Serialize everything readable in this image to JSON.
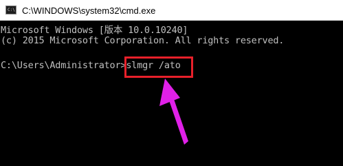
{
  "window": {
    "title": "C:\\WINDOWS\\system32\\cmd.exe",
    "icon": "cmd-icon",
    "icon_glyph": "C:\\"
  },
  "console": {
    "line1": "Microsoft Windows [版本 10.0.10240]",
    "line2": "(c) 2015 Microsoft Corporation. All rights reserved.",
    "prompt": "C:\\Users\\Administrator>",
    "command": "slmgr /ato"
  },
  "annotation": {
    "box_color": "#e8202a",
    "arrow_color": "#e020e8"
  },
  "colors": {
    "background": "#000000",
    "text": "#c0c0c0",
    "titlebar": "#ffffff"
  }
}
